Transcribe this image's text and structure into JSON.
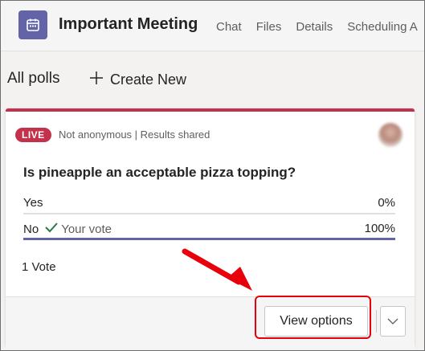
{
  "header": {
    "title": "Important Meeting",
    "tabs": [
      "Chat",
      "Files",
      "Details",
      "Scheduling A"
    ]
  },
  "toolbar": {
    "all_polls_label": "All polls",
    "create_new_label": "Create New"
  },
  "poll": {
    "badge": "LIVE",
    "meta": "Not anonymous | Results shared",
    "question": "Is pineapple an acceptable pizza topping?",
    "options": [
      {
        "label": "Yes",
        "percent": "0%",
        "fraction": 0.0
      },
      {
        "label": "No",
        "your_vote": "Your vote",
        "percent": "100%",
        "fraction": 1.0
      }
    ],
    "votes_label": "1 Vote",
    "view_options_label": "View options"
  },
  "colors": {
    "accent": "#6264a7",
    "live_red": "#c4314b",
    "annotation_red": "#e8000b"
  },
  "icons": [
    "calendar-icon",
    "plus-icon",
    "checkmark-icon",
    "chevron-down-icon",
    "avatar"
  ]
}
